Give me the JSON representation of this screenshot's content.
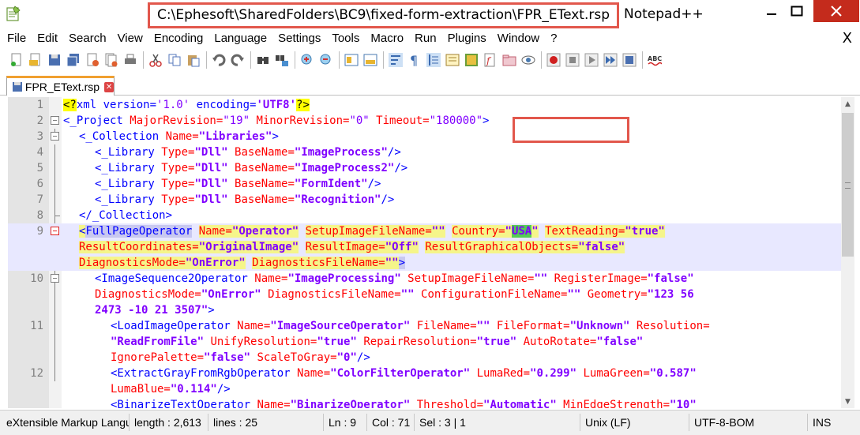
{
  "window": {
    "title_path": "C:\\Ephesoft\\SharedFolders\\BC9\\fixed-form-extraction\\FPR_EText.rsp",
    "app_name": "Notepad++"
  },
  "menu": [
    "File",
    "Edit",
    "Search",
    "View",
    "Encoding",
    "Language",
    "Settings",
    "Tools",
    "Macro",
    "Run",
    "Plugins",
    "Window",
    "?"
  ],
  "menu_close": "X",
  "toolbar_icons": [
    "new-file-icon",
    "open-file-icon",
    "save-icon",
    "save-all-icon",
    "close-icon",
    "close-all-icon",
    "print-icon",
    "cut-icon",
    "copy-icon",
    "paste-icon",
    "undo-icon",
    "redo-icon",
    "find-icon",
    "replace-icon",
    "zoom-in-icon",
    "zoom-out-icon",
    "sync-vertical-icon",
    "sync-horizontal-icon",
    "word-wrap-icon",
    "show-all-chars-icon",
    "indent-guide-icon",
    "lang-udl-icon",
    "doc-map-icon",
    "function-list-icon",
    "folder-workspace-icon",
    "monitoring-icon",
    "record-macro-icon",
    "stop-record-icon",
    "play-macro-icon",
    "run-macro-multiple-icon",
    "save-macro-icon",
    "spell-check-icon"
  ],
  "tab": {
    "label": "FPR_EText.rsp"
  },
  "lines": [
    {
      "n": "1"
    },
    {
      "n": "2"
    },
    {
      "n": "3"
    },
    {
      "n": "4"
    },
    {
      "n": "5"
    },
    {
      "n": "6"
    },
    {
      "n": "7"
    },
    {
      "n": "8"
    },
    {
      "n": "9"
    },
    {
      "n": "10"
    },
    {
      "n": "11"
    },
    {
      "n": "12"
    }
  ],
  "code": {
    "l1_a": "<?",
    "l1_b": "xml version=",
    "l1_c": "'1.0'",
    "l1_d": " encoding=",
    "l1_e": "'UTF8'",
    "l1_f": "?>",
    "l2": [
      "<_Project",
      " MajorRevision=",
      "\"19\"",
      " MinorRevision=",
      "\"0\"",
      " Timeout=",
      "\"180000\"",
      ">"
    ],
    "l3": [
      "<_Collection",
      " Name=",
      "\"Libraries\"",
      ">"
    ],
    "l4": [
      "<_Library",
      " Type=",
      "\"Dll\"",
      " BaseName=",
      "\"ImageProcess\"",
      "/>"
    ],
    "l5": [
      "<_Library",
      " Type=",
      "\"Dll\"",
      " BaseName=",
      "\"ImageProcess2\"",
      "/>"
    ],
    "l6": [
      "<_Library",
      " Type=",
      "\"Dll\"",
      " BaseName=",
      "\"FormIdent\"",
      "/>"
    ],
    "l7": [
      "<_Library",
      " Type=",
      "\"Dll\"",
      " BaseName=",
      "\"Recognition\"",
      "/>"
    ],
    "l8": [
      "</_Collection>"
    ],
    "l9a": [
      "<",
      "FullPageOperator",
      " ",
      "Name=",
      "\"Operator\"",
      " ",
      "SetupImageFileName=",
      "\"\"",
      " ",
      "Country=",
      "\"",
      "USA",
      "\"",
      " ",
      "TextReading=",
      "\"true\""
    ],
    "l9b": [
      "ResultCoordinates=",
      "\"OriginalImage\"",
      " ",
      "ResultImage=",
      "\"Off\"",
      " ",
      "ResultGraphicalObjects=",
      "\"false\""
    ],
    "l9c": [
      "DiagnosticsMode=",
      "\"OnError\"",
      " ",
      "DiagnosticsFileName=",
      "\"\"",
      ">"
    ],
    "l10a": [
      "<ImageSequence2Operator",
      " Name=",
      "\"ImageProcessing\"",
      " SetupImageFileName=",
      "\"\"",
      " RegisterImage=",
      "\"false\""
    ],
    "l10b": [
      "DiagnosticsMode=",
      "\"OnError\"",
      " DiagnosticsFileName=",
      "\"\"",
      " ConfigurationFileName=",
      "\"\"",
      " Geometry=",
      "\"123 56"
    ],
    "l10c": [
      "2473 -10 21 3507\"",
      ">"
    ],
    "l11a": [
      "<LoadImageOperator",
      " Name=",
      "\"ImageSourceOperator\"",
      " FileName=",
      "\"\"",
      " FileFormat=",
      "\"Unknown\"",
      " Resolution="
    ],
    "l11b": [
      "\"ReadFromFile\"",
      " UnifyResolution=",
      "\"true\"",
      " RepairResolution=",
      "\"true\"",
      " AutoRotate=",
      "\"false\""
    ],
    "l11c": [
      "IgnorePalette=",
      "\"false\"",
      " ScaleToGray=",
      "\"0\"",
      "/>"
    ],
    "l12a": [
      "<ExtractGrayFromRgbOperator",
      " Name=",
      "\"ColorFilterOperator\"",
      " LumaRed=",
      "\"0.299\"",
      " LumaGreen=",
      "\"0.587\""
    ],
    "l12b": [
      "LumaBlue=",
      "\"0.114\"",
      "/>"
    ],
    "l13": [
      "<BinarizeTextOperator",
      " Name=",
      "\"BinarizeOperator\"",
      " Threshold=",
      "\"Automatic\"",
      " MinEdgeStrength=",
      "\"10\""
    ]
  },
  "status": {
    "language": "eXtensible Markup Language file",
    "length": "length : 2,613",
    "lines": "lines : 25",
    "ln": "Ln : 9",
    "col": "Col : 71",
    "sel": "Sel : 3 | 1",
    "eol": "Unix (LF)",
    "encoding": "UTF-8-BOM",
    "mode": "INS"
  },
  "colors": {
    "highlight_box": "#e2574c",
    "current_line": "#e8e8ff",
    "tag": "#0000ff",
    "attr": "#ff0000",
    "value": "#8000ff"
  }
}
